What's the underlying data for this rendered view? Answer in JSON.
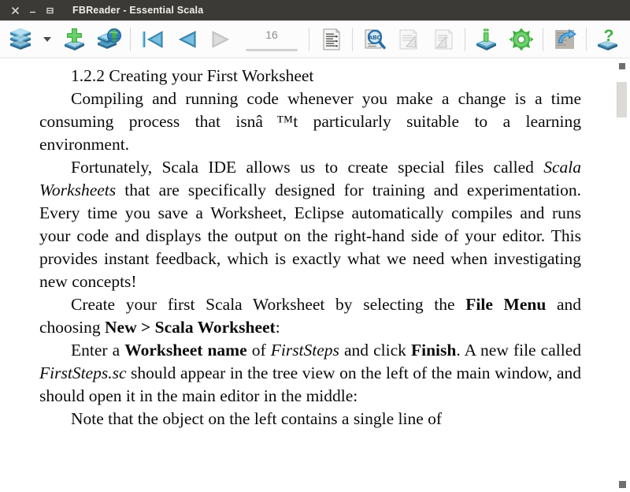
{
  "window": {
    "title": "FBReader - Essential Scala",
    "controls": [
      {
        "name": "close-button",
        "glyph": "close-icon",
        "label": "Close"
      },
      {
        "name": "minimize-button",
        "glyph": "minimize-icon",
        "label": "Minimize"
      },
      {
        "name": "maximize-button",
        "glyph": "maximize-icon",
        "label": "Maximize"
      }
    ],
    "titlebar_color": "#3b3a36",
    "titlebar_text_color": "#f2efe9"
  },
  "toolbar": {
    "items": [
      {
        "name": "library-button",
        "icon": "library-books-icon",
        "label": "Library",
        "enabled": true
      },
      {
        "name": "library-dropdown-button",
        "icon": "chevron-down-icon",
        "label": "Library menu",
        "enabled": true
      },
      {
        "name": "add-book-button",
        "icon": "add-book-plus-icon",
        "label": "Add Book",
        "enabled": true
      },
      {
        "name": "network-library-button",
        "icon": "network-library-globe-icon",
        "label": "Network Library",
        "enabled": true
      },
      {
        "name": "first-page-button",
        "icon": "skip-to-start-icon",
        "label": "Go to Start",
        "enabled": true
      },
      {
        "name": "back-button",
        "icon": "arrow-left-icon",
        "label": "Back",
        "enabled": true
      },
      {
        "name": "forward-button",
        "icon": "arrow-right-icon",
        "label": "Forward",
        "enabled": false
      },
      {
        "name": "page-number-field",
        "icon": "page-slider",
        "label": "Page",
        "enabled": true
      },
      {
        "name": "table-of-contents-button",
        "icon": "toc-document-icon",
        "label": "Table of Contents",
        "enabled": true
      },
      {
        "name": "search-button",
        "icon": "search-abc-magnifier-icon",
        "label": "Find Text",
        "enabled": true
      },
      {
        "name": "find-previous-button",
        "icon": "find-previous-document-icon",
        "label": "Find Previous",
        "enabled": false
      },
      {
        "name": "find-next-button",
        "icon": "find-next-document-icon",
        "label": "Find Next",
        "enabled": false
      },
      {
        "name": "book-info-button",
        "icon": "book-info-icon",
        "label": "Book Info",
        "enabled": true
      },
      {
        "name": "preferences-button",
        "icon": "gear-icon",
        "label": "Preferences",
        "enabled": true
      },
      {
        "name": "rotate-button",
        "icon": "rotate-arrow-icon",
        "label": "Rotate Screen",
        "enabled": true
      },
      {
        "name": "help-button",
        "icon": "help-question-icon",
        "label": "Help",
        "enabled": true
      }
    ],
    "page_number": "16"
  },
  "reader": {
    "heading": "1.2.2 Creating your First Worksheet",
    "paragraphs": [
      {
        "id": "p1",
        "runs": [
          {
            "t": "Compiling and running code whenever you make a change is a time consuming process that isnâ™t particularly suitable to a learning environment.",
            "style": "normal"
          }
        ]
      },
      {
        "id": "p2",
        "runs": [
          {
            "t": "Fortunately, Scala IDE allows us to create special files called ",
            "style": "normal"
          },
          {
            "t": "Scala Worksheets",
            "style": "italic"
          },
          {
            "t": " that are specifically designed for train­ing and experimentation. Every time you save a Worksheet, Eclipse automatically compiles and runs your code and displays the output on the right-hand side of your editor. This provides instant feedback, which is exactly what we need when investi­gating new concepts!",
            "style": "normal"
          }
        ]
      },
      {
        "id": "p3",
        "runs": [
          {
            "t": "Create your first Scala Worksheet by selecting the ",
            "style": "normal"
          },
          {
            "t": "File Menu",
            "style": "bold"
          },
          {
            "t": " and choosing ",
            "style": "normal"
          },
          {
            "t": "New > Scala Worksheet",
            "style": "bold"
          },
          {
            "t": ":",
            "style": "normal"
          }
        ]
      },
      {
        "id": "p4",
        "runs": [
          {
            "t": "Enter a ",
            "style": "normal"
          },
          {
            "t": "Worksheet name",
            "style": "bold"
          },
          {
            "t": " of ",
            "style": "normal"
          },
          {
            "t": "FirstSteps",
            "style": "italic"
          },
          {
            "t": " and click ",
            "style": "normal"
          },
          {
            "t": "Finish",
            "style": "bold"
          },
          {
            "t": ". A new file called ",
            "style": "normal"
          },
          {
            "t": "FirstSteps.sc",
            "style": "italic"
          },
          {
            "t": " should appear in the tree view on the left of the main window, and should open it in the main edi­tor in the middle:",
            "style": "normal"
          }
        ]
      },
      {
        "id": "p5",
        "runs": [
          {
            "t": "Note that the object on the left contains a single line of",
            "style": "normal"
          }
        ]
      }
    ]
  },
  "scrollbar": {
    "name": "vertical-scrollbar",
    "thumb_top_pct": 5,
    "thumb_height_pct": 8
  }
}
